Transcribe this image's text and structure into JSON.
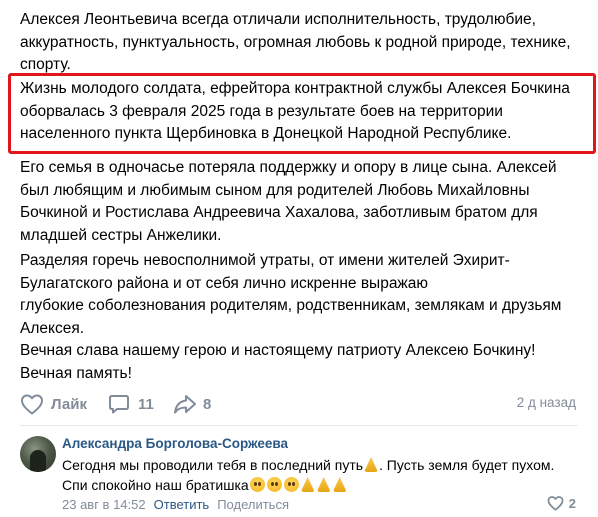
{
  "post": {
    "paragraph1": [
      "Алексея Леонтьевича всегда отличали исполнительность, трудолюбие,",
      "аккуратность, пунктуальность, огромная любовь к родной природе, технике,",
      "спорту."
    ],
    "paragraph2": [
      "Жизнь молодого солдата, ефрейтора контрактной службы Алексея Бочкина",
      "оборвалась 3 февраля 2025 года в результате боев на территории",
      "населенного пункта Щербиновка в Донецкой Народной Республике."
    ],
    "paragraph3": [
      "Его семья в одночасье потеряла поддержку и опору в лице сына. Алексей",
      "был любящим и любимым сыном для родителей Любовь Михайловны",
      "Бочкиной и Ростислава Андреевича Хахалова, заботливым братом для",
      "младшей сестры Анжелики."
    ],
    "paragraph4": [
      "Разделяя горечь невосполнимой утраты, от имени жителей Эхирит-",
      "Булагатского района и от себя лично искренне выражаю",
      "глубокие соболезнования родителям, родственникам, землякам и друзьям",
      "Алексея.",
      "Вечная слава нашему герою и настоящему патриоту Алексею Бочкину!",
      "Вечная память!"
    ],
    "highlight_color": "#e0161b",
    "actions": {
      "like_label": "Лайк",
      "like_icon": "heart-icon",
      "comments_count": "11",
      "comment_icon": "comment-bubble-icon",
      "shares_count": "8",
      "share_icon": "share-arrow-icon"
    },
    "time": "2 д назад"
  },
  "comment": {
    "author": "Александра Борголова-Соржеева",
    "line1_text": "Сегодня мы проводили тебя в последний путь",
    "line1_tail": ". Пусть земля будет пухом.",
    "line2_text": "Спи спокойно наш братишка",
    "date": "23 авг в 14:52",
    "reply_label": "Ответить",
    "share_label": "Поделиться",
    "likes_count": "2",
    "link_color": "#2a5885",
    "muted_color": "#818c99"
  }
}
